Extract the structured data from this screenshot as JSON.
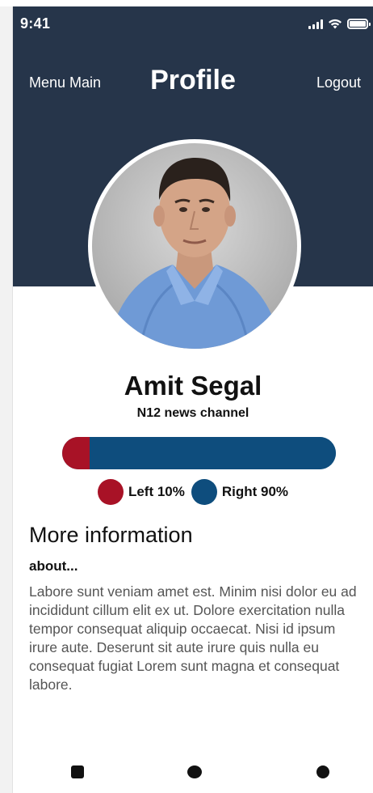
{
  "status_bar": {
    "time": "9:41"
  },
  "header": {
    "menu_label": "Menu Main",
    "title": "Profile",
    "logout_label": "Logout"
  },
  "profile": {
    "name": "Amit Segal",
    "channel": "N12 news channel"
  },
  "bias": {
    "left_percent": 10,
    "right_percent": 90,
    "left_label": "Left 10%",
    "right_label": "Right 90%",
    "left_color": "#a81226",
    "right_color": "#0e4d7d"
  },
  "more_info": {
    "title": "More information",
    "subtitle": "about...",
    "text": "Labore sunt veniam amet est. Minim nisi dolor eu ad incididunt cillum elit ex ut. Dolore exercitation nulla tempor consequat aliquip occaecat. Nisi id ipsum irure aute. Deserunt sit aute irure quis nulla eu consequat fugiat Lorem sunt magna et consequat labore."
  },
  "colors": {
    "header_bg": "#26354a",
    "text_muted": "#555555"
  }
}
